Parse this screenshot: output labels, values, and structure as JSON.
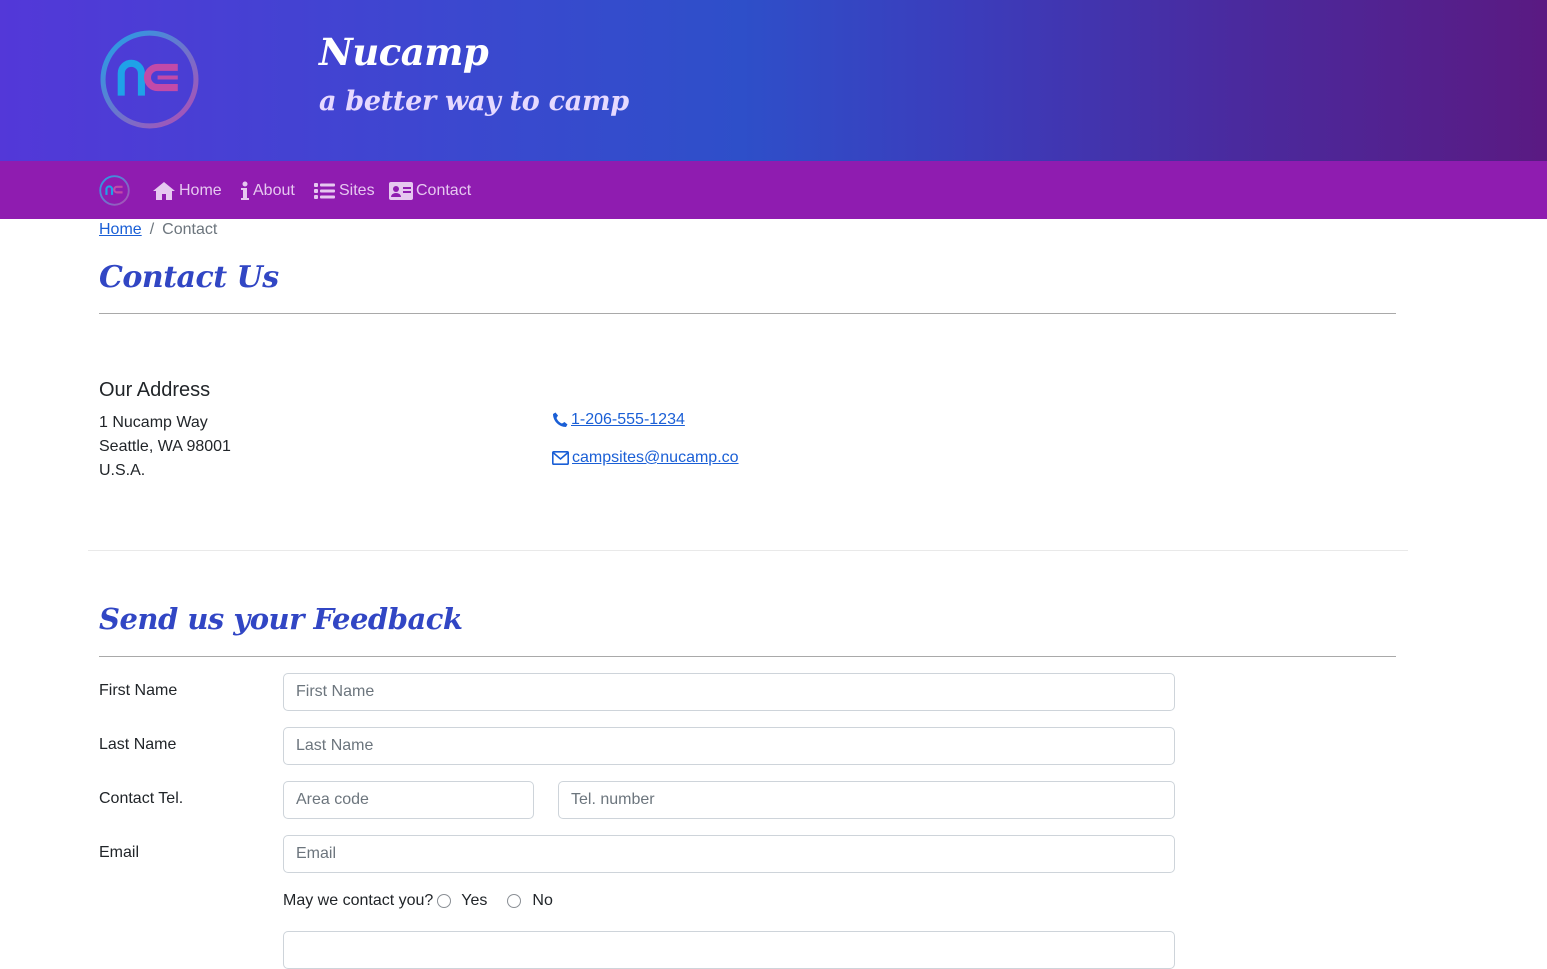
{
  "header": {
    "brand_title": "Nucamp",
    "brand_tagline": "a better way to camp",
    "logo_text": "nc"
  },
  "colors": {
    "header_gradient_start": "#5338d8",
    "header_gradient_end": "#5a1a82",
    "navbar": "#8f1cb0",
    "heading": "#3146c4",
    "link": "#1a5fd6"
  },
  "nav": {
    "items": [
      {
        "label": "Home",
        "icon": "home-icon"
      },
      {
        "label": "About",
        "icon": "info-icon"
      },
      {
        "label": "Sites",
        "icon": "list-icon"
      },
      {
        "label": "Contact",
        "icon": "address-card-icon"
      }
    ]
  },
  "breadcrumb": {
    "home": "Home",
    "separator": "/",
    "current": "Contact"
  },
  "contact": {
    "title": "Contact Us",
    "address_heading": "Our Address",
    "address_lines": [
      "1 Nucamp Way",
      "Seattle, WA 98001",
      "U.S.A."
    ],
    "phone": " 1-206-555-1234",
    "email": " campsites@nucamp.co"
  },
  "feedback": {
    "title": "Send us your Feedback",
    "first_name_label": "First Name",
    "first_name_placeholder": "First Name",
    "last_name_label": "Last Name",
    "last_name_placeholder": "Last Name",
    "tel_label": "Contact Tel.",
    "area_code_placeholder": "Area code",
    "tel_number_placeholder": "Tel. number",
    "email_label": "Email",
    "email_placeholder": "Email",
    "contact_question": "May we contact you?",
    "yes_label": "Yes",
    "no_label": "No"
  }
}
